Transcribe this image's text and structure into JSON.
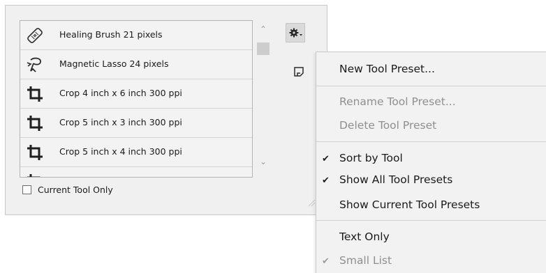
{
  "presets_panel": {
    "items": [
      {
        "icon": "healing-brush-icon",
        "label": "Healing Brush 21 pixels"
      },
      {
        "icon": "magnetic-lasso-icon",
        "label": "Magnetic Lasso 24 pixels"
      },
      {
        "icon": "crop-icon",
        "label": "Crop 4 inch x 6 inch 300 ppi"
      },
      {
        "icon": "crop-icon",
        "label": "Crop 5 inch x 3 inch 300 ppi"
      },
      {
        "icon": "crop-icon",
        "label": "Crop 5 inch x 4 inch 300 ppi"
      }
    ],
    "current_tool_only_label": "Current Tool Only",
    "current_tool_only_checked": false
  },
  "menu": {
    "new_tool_preset": "New Tool Preset...",
    "rename_tool_preset": "Rename Tool Preset...",
    "delete_tool_preset": "Delete Tool Preset",
    "sort_by_tool": "Sort by Tool",
    "show_all_tool_presets": "Show All Tool Presets",
    "show_current_tool_presets": "Show Current Tool Presets",
    "text_only": "Text Only",
    "small_list": "Small List"
  }
}
